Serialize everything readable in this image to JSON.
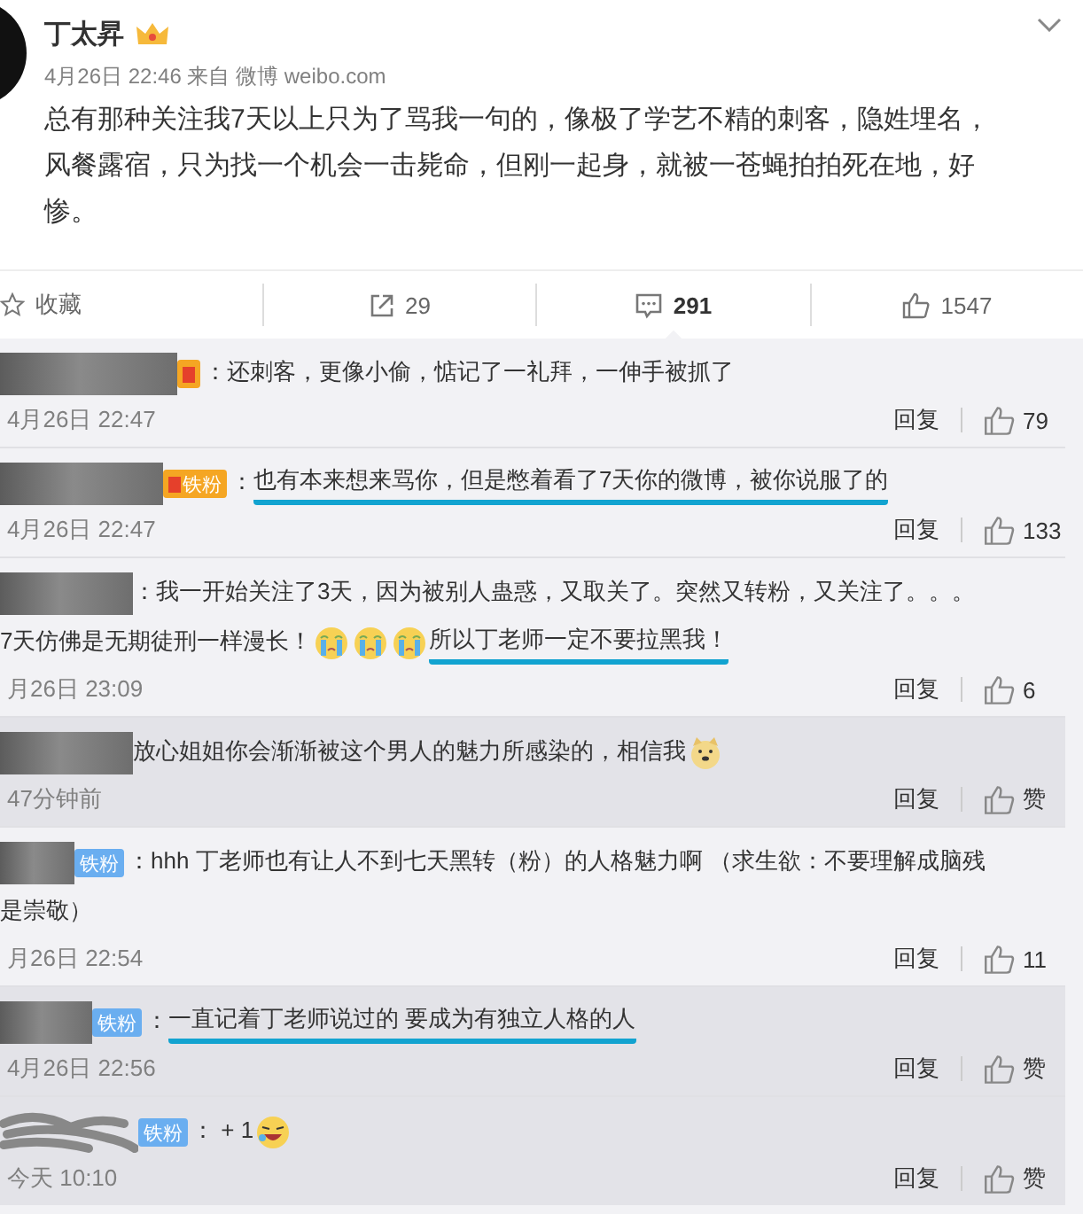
{
  "post": {
    "author": "丁太昇",
    "meta": "4月26日 22:46 来自 微博 weibo.com",
    "text": "总有那种关注我7天以上只为了骂我一句的，像极了学艺不精的刺客，隐姓埋名，风餐露宿，只为找一个机会一击毙命，但刚一起身，就被一苍蝇拍拍死在地，好惨。"
  },
  "actions": [
    {
      "kind": "star",
      "label": "收藏",
      "selected": false
    },
    {
      "kind": "share",
      "label": "29",
      "selected": false
    },
    {
      "kind": "comment",
      "label": "291",
      "selected": true
    },
    {
      "kind": "like",
      "label": "1547",
      "selected": false
    }
  ],
  "comments": [
    {
      "nested": false,
      "badge": {
        "kind": "gold"
      },
      "lines": [
        [
          {
            "kind": "text",
            "text": "：还刺客，更像小偷，惦记了一礼拜，一伸手被抓了",
            "underlined": false
          }
        ]
      ],
      "time": "4月26日 22:47",
      "reply": "回复",
      "likes": "79"
    },
    {
      "nested": false,
      "badge": {
        "kind": "gold",
        "label": "铁粉"
      },
      "lines": [
        [
          {
            "kind": "text",
            "text": "：",
            "underlined": false
          },
          {
            "kind": "text",
            "text": "也有本来想来骂你，但是憋着看了7天你的微博，被你说服了的",
            "underlined": true
          }
        ]
      ],
      "time": "4月26日 22:47",
      "reply": "回复",
      "likes": "133"
    },
    {
      "nested": false,
      "lines": [
        [
          {
            "kind": "text",
            "text": "：我一开始关注了3天，因为被别人蛊惑，又取关了。突然又转粉，又关注了。。。",
            "underlined": false
          }
        ],
        [
          {
            "kind": "text",
            "text": "7天仿佛是无期徒刑一样漫长！",
            "underlined": false
          },
          {
            "kind": "crying"
          },
          {
            "kind": "crying"
          },
          {
            "kind": "crying"
          },
          {
            "kind": "text",
            "text": "所以丁老师一定不要拉黑我！",
            "underlined": true
          }
        ]
      ],
      "time": "月26日 23:09",
      "reply": "回复",
      "likes": "6"
    },
    {
      "nested": true,
      "lines": [
        [
          {
            "kind": "text",
            "text": "放心姐姐你会渐渐被这个男人的魅力所感染的，相信我",
            "underlined": false
          },
          {
            "kind": "dog"
          }
        ]
      ],
      "time": "47分钟前",
      "reply": "回复",
      "likes": "赞"
    },
    {
      "nested": false,
      "badge": {
        "kind": "blue",
        "label": "铁粉"
      },
      "lines": [
        [
          {
            "kind": "text",
            "text": "：hhh 丁老师也有让人不到七天黑转（粉）的人格魅力啊 （求生欲：不要理解成脑残",
            "underlined": false
          }
        ],
        [
          {
            "kind": "text",
            "text": "是崇敬）",
            "underlined": false
          }
        ]
      ],
      "time": "月26日 22:54",
      "reply": "回复",
      "likes": "11"
    },
    {
      "nested": true,
      "badge": {
        "kind": "blue",
        "label": "铁粉"
      },
      "lines": [
        [
          {
            "kind": "text",
            "text": "：",
            "underlined": false
          },
          {
            "kind": "text",
            "text": "一直记着丁老师说过的 要成为有独立人格的人",
            "underlined": true
          }
        ]
      ],
      "time": "4月26日 22:56",
      "reply": "回复",
      "likes": "赞"
    },
    {
      "nested": true,
      "scribble": true,
      "badge": {
        "kind": "blue",
        "label": "铁粉"
      },
      "lines": [
        [
          {
            "kind": "text",
            "text": "：  + 1",
            "underlined": false
          },
          {
            "kind": "laughing"
          }
        ]
      ],
      "time": "今天 10:10",
      "reply": "回复",
      "likes": "赞"
    }
  ]
}
